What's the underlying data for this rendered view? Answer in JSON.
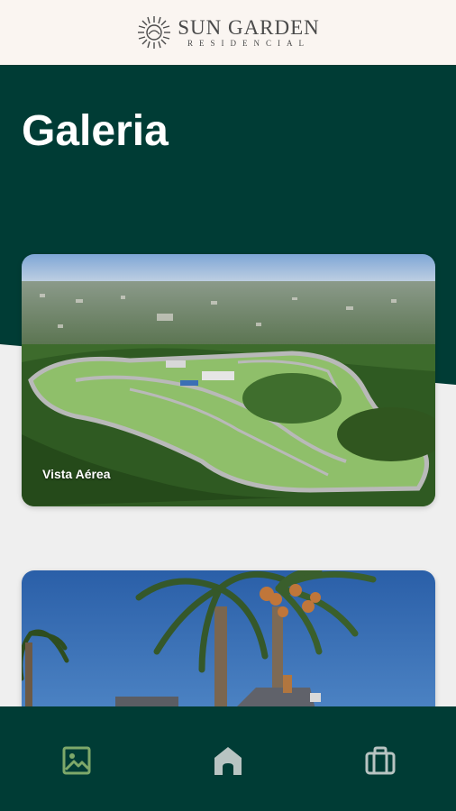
{
  "header": {
    "logo_title": "SUN GARDEN",
    "logo_subtitle": "RESIDENCIAL"
  },
  "main": {
    "title": "Galeria",
    "gallery": [
      {
        "label": "Vista Aérea"
      },
      {
        "label": ""
      }
    ]
  },
  "bottom_nav": {
    "items": [
      {
        "icon": "gallery-icon",
        "active": true
      },
      {
        "icon": "home-icon",
        "active": false
      },
      {
        "icon": "briefcase-icon",
        "active": false
      }
    ]
  },
  "colors": {
    "primary": "#003c35",
    "header_bg": "#faf5f1",
    "page_bg": "#efefef",
    "nav_active": "#7ea86a",
    "nav_inactive": "#b8c4c2"
  }
}
